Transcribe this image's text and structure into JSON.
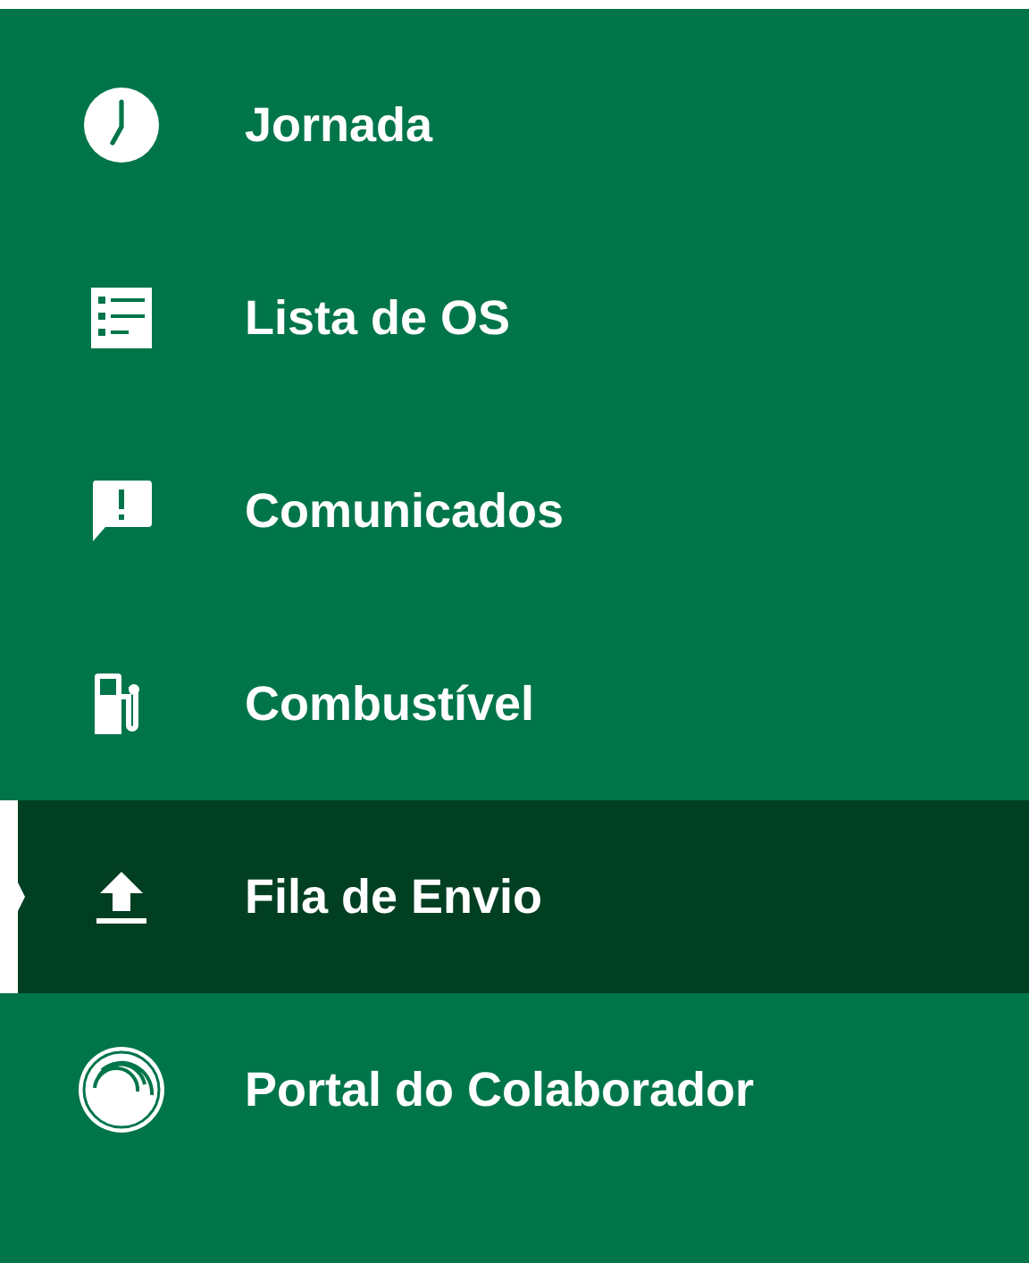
{
  "menu": {
    "items": [
      {
        "label": "Jornada",
        "selected": false
      },
      {
        "label": "Lista de OS",
        "selected": false
      },
      {
        "label": "Comunicados",
        "selected": false
      },
      {
        "label": "Combustível",
        "selected": false
      },
      {
        "label": "Fila de Envio",
        "selected": true
      },
      {
        "label": "Portal do Colaborador",
        "selected": false
      }
    ]
  }
}
